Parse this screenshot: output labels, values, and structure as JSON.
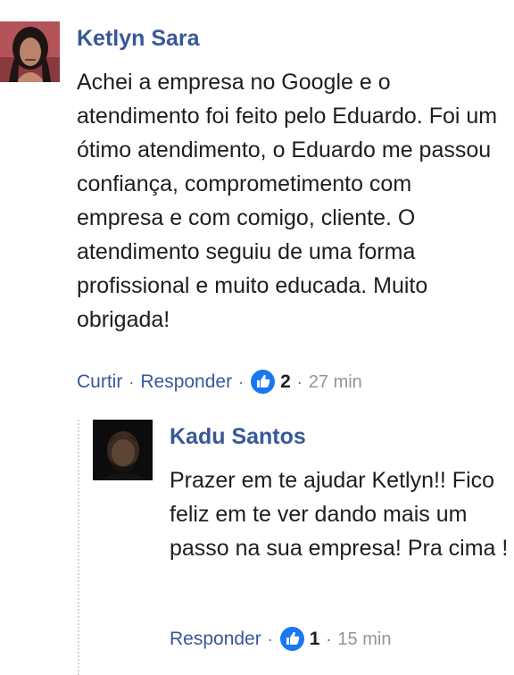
{
  "comment": {
    "author": "Ketlyn Sara",
    "text": "Achei a empresa no Google e o atendimento foi feito pelo Eduardo. Foi um ótimo atendimento, o Eduardo me passou confiança, comprometimento com empresa e com comigo, cliente. O atendimento seguiu de uma forma profissional e muito educada. Muito obrigada!",
    "actions": {
      "like_label": "Curtir",
      "reply_label": "Responder",
      "separator": "·",
      "reaction_icon": "thumbs-up-icon",
      "reaction_count": "2",
      "timestamp": "27 min"
    }
  },
  "reply": {
    "author": "Kadu Santos",
    "text": "Prazer em te ajudar Ketlyn!! Fico feliz em te ver dando mais um passo na sua empresa! Pra cima !",
    "actions": {
      "reply_label": "Responder",
      "separator": "·",
      "reaction_icon": "thumbs-up-icon",
      "reaction_count": "1",
      "timestamp": "15 min"
    }
  },
  "colors": {
    "link": "#385898",
    "text": "#1c1e21",
    "meta": "#90949c",
    "like_blue": "#1877f2"
  }
}
